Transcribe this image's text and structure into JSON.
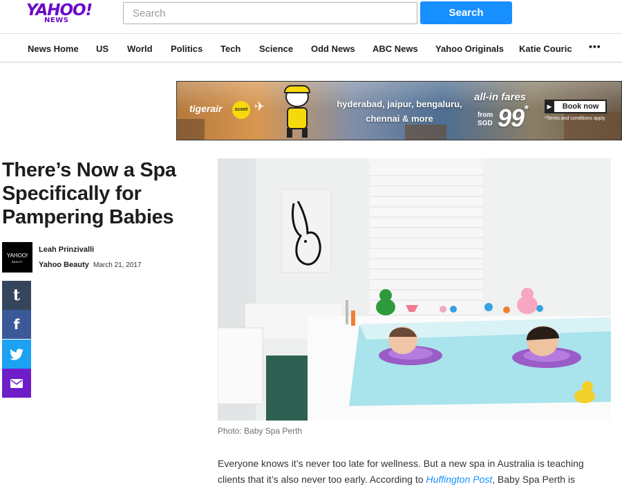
{
  "brand": {
    "logo_main": "YAHOO!",
    "logo_sub": "NEWS",
    "color": "#6b0ac9"
  },
  "search": {
    "placeholder": "Search",
    "button_label": "Search",
    "button_color": "#188fff"
  },
  "nav": {
    "items": [
      {
        "label": "News Home"
      },
      {
        "label": "US"
      },
      {
        "label": "World"
      },
      {
        "label": "Politics"
      },
      {
        "label": "Tech"
      },
      {
        "label": "Science"
      },
      {
        "label": "Odd News"
      },
      {
        "label": "ABC News"
      },
      {
        "label": "Yahoo Originals"
      },
      {
        "label": "Katie Couric"
      }
    ],
    "more_label": "•••"
  },
  "ad": {
    "brand": "tigerair",
    "badge": "scoot",
    "cities_line1": "hyderabad, jaipur, bengaluru,",
    "cities_line2": "chennai & more",
    "fares_label": "all-in fares",
    "from_label": "from",
    "currency": "SGD",
    "price": "99",
    "price_suffix": "*",
    "cta": "Book now",
    "terms": "*Terms and conditions apply"
  },
  "article": {
    "headline": "There’s Now a Spa Specifically for Pampering Babies",
    "author": "Leah Prinzivalli",
    "publication": "Yahoo Beauty",
    "date": "March 21, 2017",
    "avatar_text": "YAHOO!",
    "avatar_sub": "BEAUTY",
    "photo_caption": "Photo: Baby Spa Perth",
    "body_part1": "Everyone knows it’s never too late for wellness. But a new spa in Australia is teaching clients that it’s also never too early. According to ",
    "body_link": "Huffington Post",
    "body_part2": ", Baby Spa Perth is"
  },
  "share": {
    "tumblr_glyph": "t",
    "facebook_glyph": "f",
    "colors": {
      "tumblr": "#35465c",
      "facebook": "#3b5998",
      "twitter": "#1da1f2",
      "mail": "#6e1ec9"
    }
  }
}
